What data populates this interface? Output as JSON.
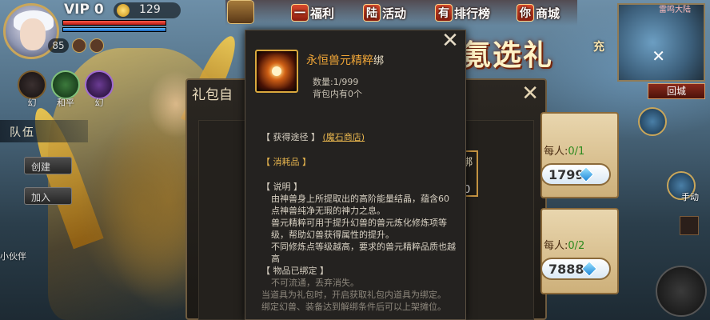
{
  "hud": {
    "vip": "VIP 0",
    "gold": "129",
    "level": "85",
    "skills": [
      {
        "label": "幻"
      },
      {
        "label": "和平"
      },
      {
        "label": "幻"
      }
    ],
    "team_tab": "队伍",
    "side_buttons": [
      "创建",
      "加入"
    ],
    "side_foot": "小伙伴"
  },
  "top_menu": [
    {
      "badge": "一",
      "label": "福利"
    },
    {
      "badge": "陆",
      "label": "活动"
    },
    {
      "badge": "有",
      "label": "排行榜"
    },
    {
      "badge": "你",
      "label": "商城"
    }
  ],
  "event_banner": "氪选礼",
  "charge_btn": "充",
  "minimap": {
    "title": "雷鸣大陆",
    "back": "回城",
    "round_labels": [
      "手动"
    ]
  },
  "gift_dialog": {
    "title": "礼包自"
  },
  "rewards": [
    {
      "label": "每人:",
      "count": "0/1",
      "price": "1799"
    },
    {
      "label": "每人:",
      "count": "0/2",
      "price": "7888"
    }
  ],
  "slot_peek": {
    "text": "绑",
    "num": "0"
  },
  "tooltip": {
    "name": "永恒兽元精粹",
    "bind_tag": "绑",
    "quantity": "数量:1/999",
    "in_bag": "背包内有0个",
    "source_label": "【 获得途径 】",
    "source_link": "(魔石商店)",
    "type_tag": "【 消耗品 】",
    "desc_label": "【 说明 】",
    "desc_lines": [
      "由神兽身上所提取出的高阶能量结晶，蕴含60点神兽纯净无瑕的神力之息。",
      "兽元精粹可用于提升幻兽的兽元炼化修炼项等级，帮助幻兽获得属性的提升。",
      "不同修炼点等级越高，要求的兽元精粹品质也越高"
    ],
    "bound_label": "【 物品已绑定 】",
    "bound_lines": [
      "不可流通，丢弃消失。",
      "当道具为礼包时，开启获取礼包内道具为绑定。",
      "绑定幻兽、装备达到解绑条件后可以上架摊位。"
    ]
  },
  "colors": {
    "item_name": "#f0a637",
    "link": "#e8b64e",
    "tooltip_bg": "#242220"
  }
}
